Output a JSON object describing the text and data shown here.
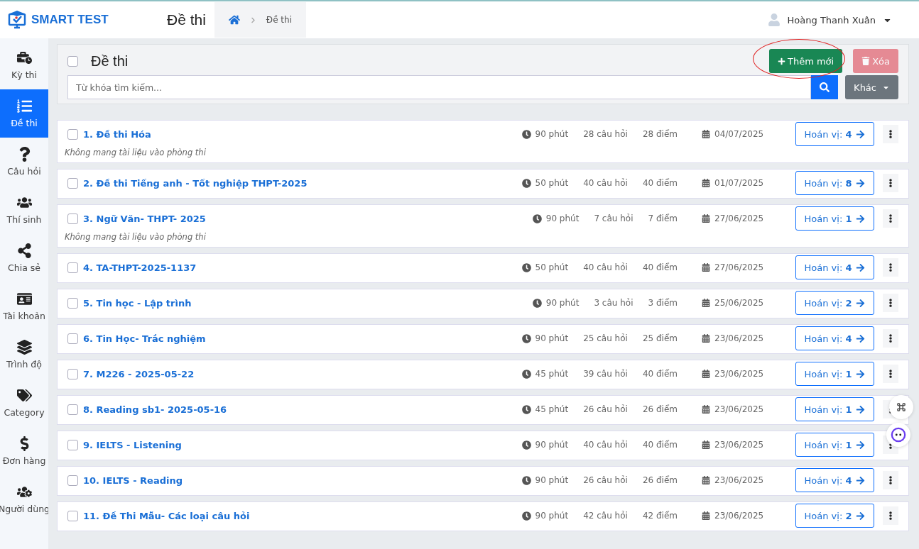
{
  "brand": "SMART TEST",
  "page_title": "Đề thi",
  "breadcrumb": [
    "Đề thi"
  ],
  "user": {
    "name": "Hoàng Thanh Xuân"
  },
  "sidebar": [
    {
      "label": "Kỳ thi",
      "selected": false
    },
    {
      "label": "Đề thi",
      "selected": true
    },
    {
      "label": "Câu hỏi",
      "selected": false
    },
    {
      "label": "Thí sinh",
      "selected": false
    },
    {
      "label": "Chia sẻ",
      "selected": false
    },
    {
      "label": "Tài khoản",
      "selected": false
    },
    {
      "label": "Trình độ",
      "selected": false
    },
    {
      "label": "Category",
      "selected": false
    },
    {
      "label": "Đơn hàng",
      "selected": false
    },
    {
      "label": "Người dùng",
      "selected": false
    }
  ],
  "toolbar": {
    "title": "Đề thi",
    "select_all": false,
    "add_button": {
      "label": "Thêm mới",
      "highlighted": true
    },
    "delete_button": {
      "label": "Xóa",
      "disabled": true
    },
    "search": {
      "placeholder": "Từ khóa tìm kiếm..."
    },
    "more_button": "Khác"
  },
  "exams": [
    {
      "title": "1. Đề thi Hóa",
      "note": "Không mang tài liệu vào phòng thi",
      "duration": "90 phút",
      "questions": "28 câu hỏi",
      "points": "28 điểm",
      "date": "04/07/2025",
      "perm_label": "Hoán vị:",
      "perm_count": "4",
      "checked": false
    },
    {
      "title": "2. Đề thi Tiếng anh - Tốt nghiệp THPT-2025",
      "duration": "50 phút",
      "questions": "40 câu hỏi",
      "points": "40 điểm",
      "date": "01/07/2025",
      "perm_label": "Hoán vị:",
      "perm_count": "8",
      "checked": false
    },
    {
      "title": "3. Ngữ Văn- THPT- 2025",
      "note": "Không mang tài liệu vào phòng thi",
      "duration": "90 phút",
      "questions": "7 câu hỏi",
      "points": "7 điểm",
      "date": "27/06/2025",
      "perm_label": "Hoán vị:",
      "perm_count": "1",
      "checked": false
    },
    {
      "title": "4. TA-THPT-2025-1137",
      "duration": "50 phút",
      "questions": "40 câu hỏi",
      "points": "40 điểm",
      "date": "27/06/2025",
      "perm_label": "Hoán vị:",
      "perm_count": "4",
      "checked": false
    },
    {
      "title": "5. Tin học - Lập trình",
      "duration": "90 phút",
      "questions": "3 câu hỏi",
      "points": "3 điểm",
      "date": "25/06/2025",
      "perm_label": "Hoán vị:",
      "perm_count": "2",
      "checked": false
    },
    {
      "title": "6. Tin Học- Trắc nghiệm",
      "duration": "90 phút",
      "questions": "25 câu hỏi",
      "points": "25 điểm",
      "date": "23/06/2025",
      "perm_label": "Hoán vị:",
      "perm_count": "4",
      "checked": false
    },
    {
      "title": "7. M226 - 2025-05-22",
      "duration": "45 phút",
      "questions": "39 câu hỏi",
      "points": "40 điểm",
      "date": "23/06/2025",
      "perm_label": "Hoán vị:",
      "perm_count": "1",
      "checked": false
    },
    {
      "title": "8. Reading sb1- 2025-05-16",
      "duration": "45 phút",
      "questions": "26 câu hỏi",
      "points": "26 điểm",
      "date": "23/06/2025",
      "perm_label": "Hoán vị:",
      "perm_count": "1",
      "checked": false
    },
    {
      "title": "9. IELTS - Listening",
      "duration": "90 phút",
      "questions": "40 câu hỏi",
      "points": "40 điểm",
      "date": "23/06/2025",
      "perm_label": "Hoán vị:",
      "perm_count": "1",
      "checked": false
    },
    {
      "title": "10. IELTS - Reading",
      "duration": "90 phút",
      "questions": "26 câu hỏi",
      "points": "26 điểm",
      "date": "23/06/2025",
      "perm_label": "Hoán vị:",
      "perm_count": "4",
      "checked": false
    },
    {
      "title": "11. Đề Thi Mẫu- Các loại câu hỏi",
      "duration": "90 phút",
      "questions": "42 câu hỏi",
      "points": "42 điểm",
      "date": "23/06/2025",
      "perm_label": "Hoán vị:",
      "perm_count": "2",
      "checked": false
    }
  ]
}
